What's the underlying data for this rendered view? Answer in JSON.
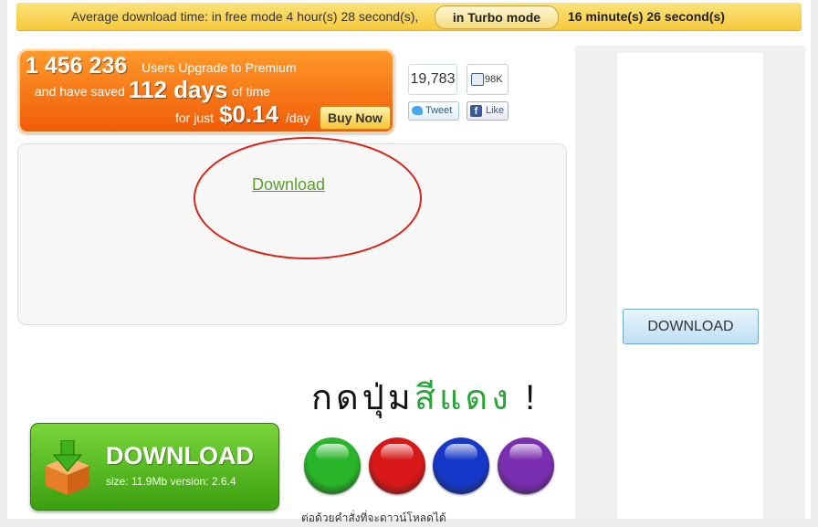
{
  "top_banner": {
    "prefix_text": "Average download time: in free mode 4 hour(s) 28 second(s),",
    "turbo_label": "in Turbo mode",
    "turbo_time": "16 minute(s) 26 second(s)"
  },
  "promo": {
    "users_count": "1 456 236",
    "users_text": "Users Upgrade to Premium",
    "saved_prefix": "and have saved",
    "days": "112 days",
    "days_suffix": "of time",
    "price_prefix": "for just",
    "price": "$0.14",
    "price_suffix": "/day",
    "buy_label": "Buy Now"
  },
  "social": {
    "tweet_count": "19,783",
    "tweet_label": "Tweet",
    "like_count": "98K",
    "like_label": "Like"
  },
  "download_box": {
    "link_label": "Download",
    "annotation_color": "#d9261c"
  },
  "sidebar": {
    "download_label": "DOWNLOAD"
  },
  "instruction": {
    "text_black": "กดปุ่ม",
    "text_green": "สีแดง",
    "text_end": "!"
  },
  "big_download": {
    "title": "DOWNLOAD",
    "meta": "size: 11.9Mb  version: 2.6.4"
  },
  "round_buttons": [
    {
      "name": "green-round-button",
      "color": "#29b52a"
    },
    {
      "name": "red-round-button",
      "color": "#d81818"
    },
    {
      "name": "blue-round-button",
      "color": "#1638c8"
    },
    {
      "name": "purple-round-button",
      "color": "#7a2fb0"
    }
  ],
  "bottom_text": "ต่อด้วยคำสั่งที่จะดาวน์โหลดได้"
}
